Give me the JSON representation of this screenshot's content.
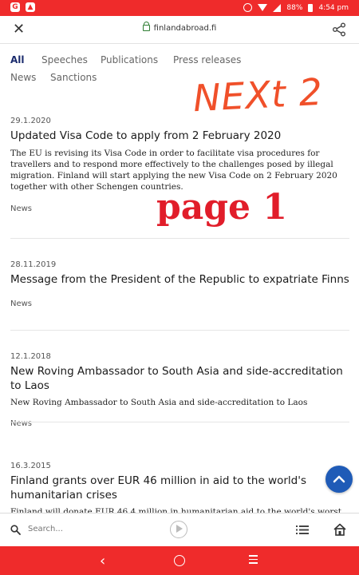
{
  "status_bar": {
    "battery": "88%",
    "time": "4:54 pm"
  },
  "url_bar": {
    "url": "finlandabroad.fi"
  },
  "tabs": [
    "All",
    "Speeches",
    "Publications",
    "Press releases",
    "News",
    "Sanctions"
  ],
  "annotations": {
    "top": "NEXt 2",
    "middle": "page 1"
  },
  "articles": [
    {
      "date": "29.1.2020",
      "title": "Updated Visa Code to apply from 2 February 2020",
      "summary": "The EU is revising its Visa Code in order to facilitate visa procedures for travellers and to respond more effectively to the challenges posed by illegal migration. Finland will start applying the new Visa Code on 2 February 2020 together with other Schengen countries.",
      "tag": "News"
    },
    {
      "date": "28.11.2019",
      "title": "Message from the President of the Republic to expatriate Finns",
      "summary": "",
      "tag": "News"
    },
    {
      "date": "12.1.2018",
      "title": "New Roving Ambassador to South Asia and side-accreditation to Laos",
      "summary": "New Roving Ambassador to South Asia and side-accreditation to Laos",
      "tag": "News"
    },
    {
      "date": "16.3.2015",
      "title": "Finland grants over EUR 46 million in aid to the world's humanitarian crises",
      "summary": "Finland will donate EUR 46.4 million in humanitarian aid to the world's worst",
      "tag": ""
    }
  ],
  "toolbar": {
    "search_placeholder": "Search..."
  }
}
